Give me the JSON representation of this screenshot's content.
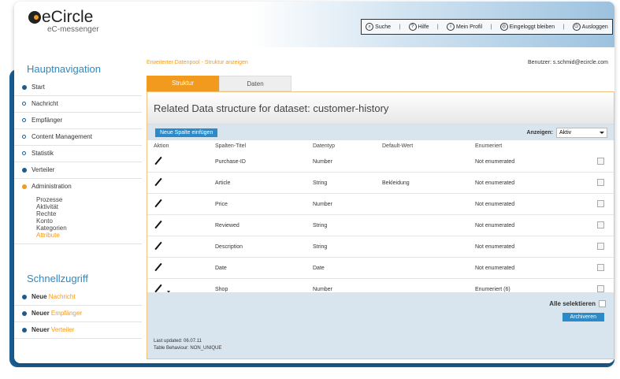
{
  "header": {
    "brand": "eCircle",
    "product": "eC-messenger",
    "toolbar": [
      {
        "icon": "search-icon",
        "label": "Suche"
      },
      {
        "icon": "help-icon",
        "label": "Hilfe"
      },
      {
        "icon": "profile-icon",
        "label": "Mein Profil"
      },
      {
        "icon": "stay-logged-in-icon",
        "label": "Eingeloggt bleiben"
      },
      {
        "icon": "logout-icon",
        "label": "Ausloggen"
      }
    ]
  },
  "sidebar": {
    "title": "Hauptnavigation",
    "items": [
      {
        "label": "Start"
      },
      {
        "label": "Nachricht"
      },
      {
        "label": "Empfänger"
      },
      {
        "label": "Content Management"
      },
      {
        "label": "Statistik"
      },
      {
        "label": "Verteiler"
      },
      {
        "label": "Administration"
      }
    ],
    "sub_items": [
      "Prozesse",
      "Aktivität",
      "Rechte",
      "Konto",
      "Kategorien",
      "Attribute"
    ],
    "quick_title": "Schnellzugriff",
    "quick_items": [
      {
        "prefix": "Neue",
        "label": "Nachricht"
      },
      {
        "prefix": "Neuer",
        "label": "Empfänger"
      },
      {
        "prefix": "Neuer",
        "label": "Verteiler"
      }
    ]
  },
  "main": {
    "breadcrumb": "Erweiterter Datenpool - Struktur anzeigen",
    "user": "Benutzer: s.schmid@ecircle.com",
    "tabs": [
      {
        "label": "Struktur"
      },
      {
        "label": "Daten"
      }
    ],
    "panel_title": "Related Data structure for dataset: customer-history",
    "add_column_button": "Neue Spalte einfügen",
    "show_label": "Anzeigen:",
    "show_value": "Aktiv",
    "columns": [
      "Aktion",
      "Spalten-Titel",
      "Datentyp",
      "Default-Wert",
      "Enumeriert"
    ],
    "rows": [
      {
        "title": "Purchase-ID",
        "type": "Number",
        "default": "",
        "enum": "Not enumerated"
      },
      {
        "title": "Article",
        "type": "String",
        "default": "Bekleidung",
        "enum": "Not enumerated"
      },
      {
        "title": "Price",
        "type": "Number",
        "default": "",
        "enum": "Not enumerated"
      },
      {
        "title": "Reviewed",
        "type": "String",
        "default": "",
        "enum": "Not enumerated"
      },
      {
        "title": "Description",
        "type": "String",
        "default": "",
        "enum": "Not enumerated"
      },
      {
        "title": "Date",
        "type": "Date",
        "default": "",
        "enum": "Not enumerated"
      },
      {
        "title": "Shop",
        "type": "Number",
        "default": "",
        "enum": "Enumeriert (6)"
      }
    ],
    "select_all": "Alle selektieren",
    "archive_button": "Archiveren",
    "last_updated": "Last updated: 06.07.11",
    "table_behaviour": "Table Behaviour: NON_UNIQUE"
  },
  "colors": {
    "accent": "#f29a1e",
    "link_blue": "#2b8ac7",
    "nav_dark": "#1e5a8c",
    "bar_bg": "#d8e4ee"
  }
}
